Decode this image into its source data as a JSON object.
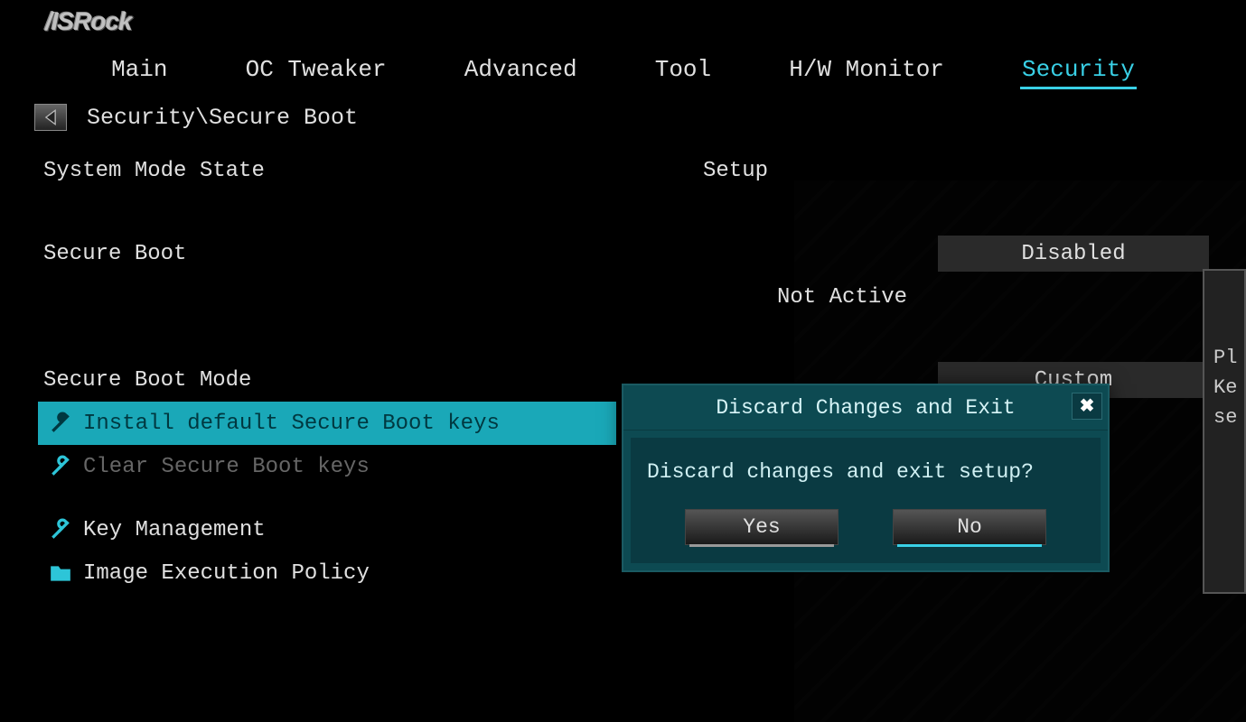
{
  "brand": "/ISRock",
  "tabs": {
    "items": [
      "Main",
      "OC Tweaker",
      "Advanced",
      "Tool",
      "H/W Monitor",
      "Security"
    ],
    "active_index": 5
  },
  "breadcrumb": "Security\\Secure Boot",
  "settings": {
    "system_mode_state": {
      "label": "System Mode State",
      "value": "Setup"
    },
    "secure_boot": {
      "label": "Secure Boot",
      "value": "Disabled",
      "status": "Not Active"
    },
    "secure_boot_mode": {
      "label": "Secure Boot Mode",
      "value": "Custom"
    }
  },
  "actions": {
    "install_keys": "Install default Secure Boot keys",
    "clear_keys": "Clear Secure Boot keys",
    "key_mgmt": "Key Management",
    "img_exec": "Image Execution Policy"
  },
  "side_help": {
    "line1": "Pl",
    "line2": "Ke",
    "line3": "se"
  },
  "dialog": {
    "title": "Discard Changes and Exit",
    "message": "Discard changes and exit setup?",
    "yes": "Yes",
    "no": "No"
  }
}
